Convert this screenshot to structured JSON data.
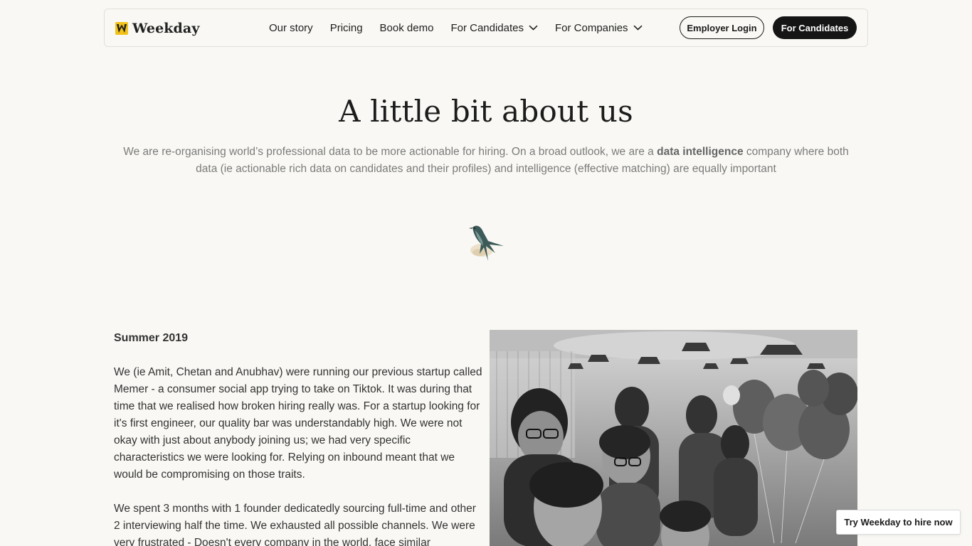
{
  "nav": {
    "brand": "Weekday",
    "links": [
      {
        "label": "Our story"
      },
      {
        "label": "Pricing"
      },
      {
        "label": "Book demo"
      },
      {
        "label": "For Candidates"
      },
      {
        "label": "For Companies"
      }
    ],
    "employer_login": "Employer Login",
    "for_candidates_button": "For Candidates"
  },
  "hero": {
    "title": "A little bit about us",
    "subtitle_before": "We are re-organising world’s professional data to be more actionable for hiring. On a broad outlook, we are a ",
    "subtitle_bold": "data intelligence",
    "subtitle_after": " company where both data (ie actionable rich data on candidates and their profiles) and intelligence (effective matching) are equally important"
  },
  "story": {
    "heading": "Summer 2019",
    "paragraphs": [
      "We (ie Amit, Chetan and Anubhav) were running our previous startup called Memer - a consumer social app trying to take on Tiktok. It was during that time that we realised how broken hiring really was. For a startup looking for it's first engineer, our quality bar was understandably high. We were not okay with just about anybody joining us; we had very specific characteristics we were looking for. Relying on inbound meant that we would be compromising on those traits.",
      "We spent 3 months with 1 founder dedicatedly sourcing full-time and other 2 interviewing half the time. We exhausted all possible channels. We were very frustrated - Doesn't every company in the world, face similar"
    ]
  },
  "cta": {
    "label": "Try Weekday to hire now"
  },
  "colors": {
    "background": "#f9f8f4",
    "primary_button": "#151515",
    "logo_accent": "#f2c21a"
  }
}
